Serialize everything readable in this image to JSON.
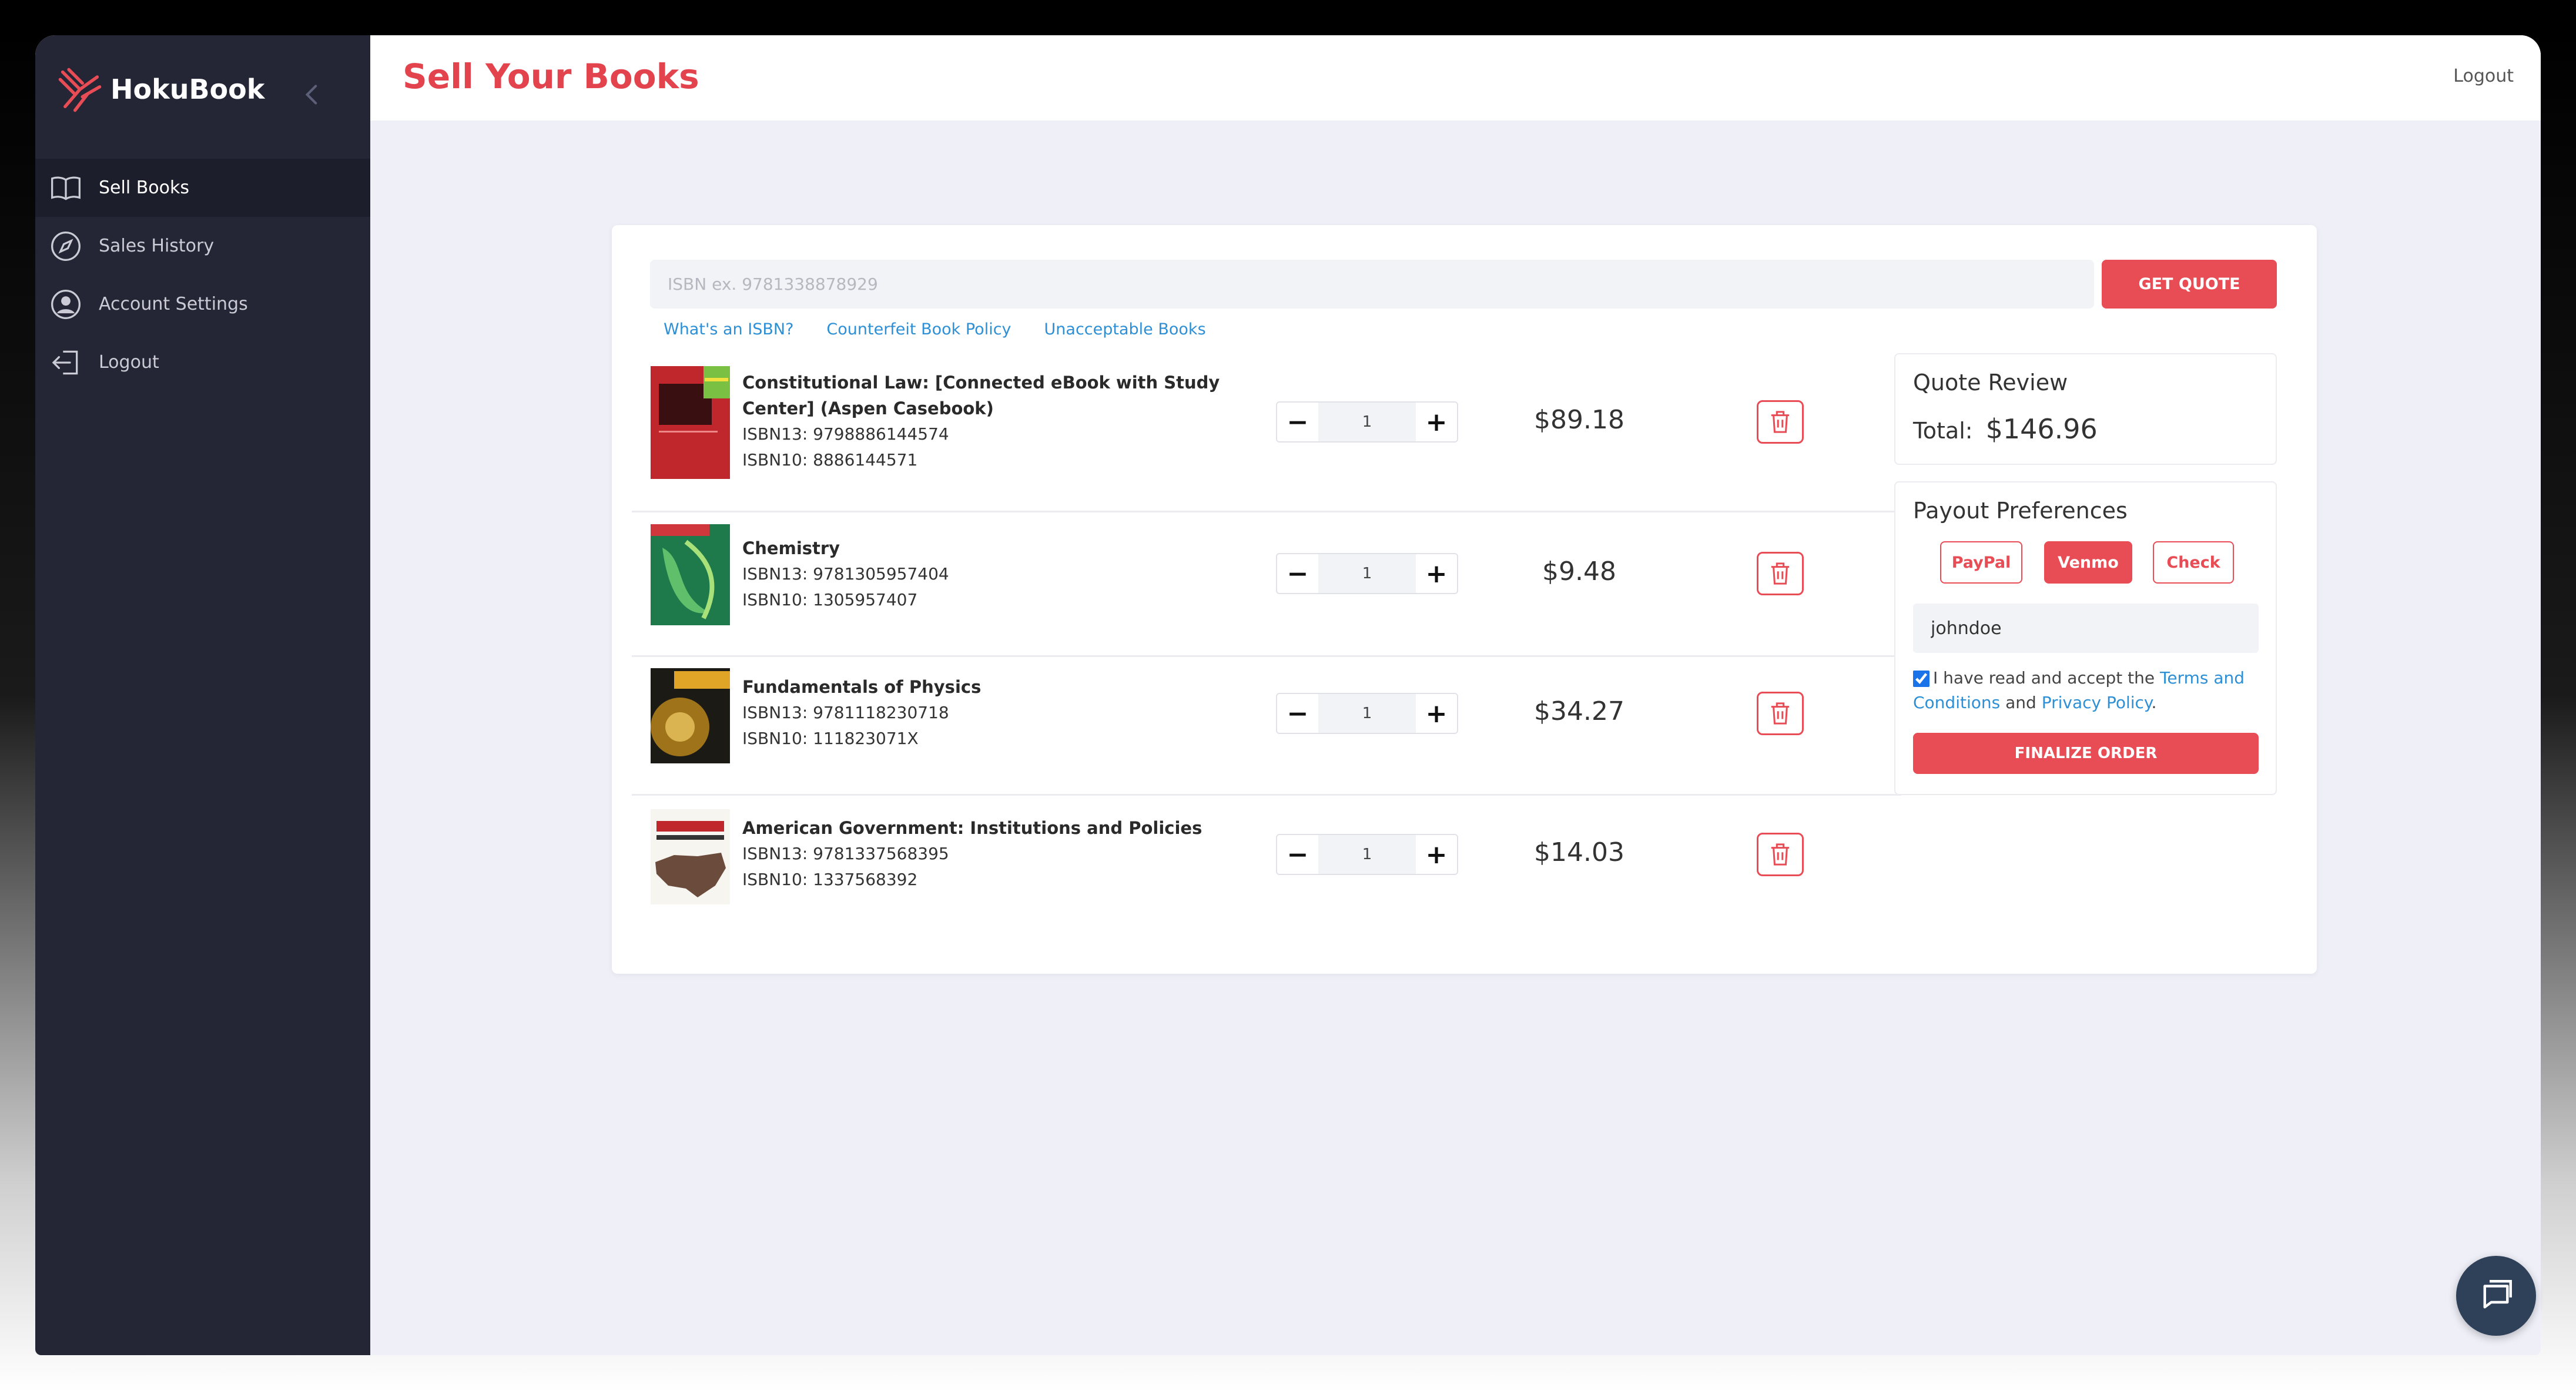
{
  "app": {
    "name": "HokuBook"
  },
  "sidebar": {
    "items": [
      {
        "label": "Sales History",
        "icon": "compass-icon"
      },
      {
        "label": "Account Settings",
        "icon": "user-circle-icon"
      },
      {
        "label": "Logout",
        "icon": "logout-icon"
      }
    ],
    "active": {
      "label": "Sell Books",
      "icon": "book-icon"
    }
  },
  "header": {
    "title": "Sell Your Books",
    "logout_label": "Logout"
  },
  "search": {
    "placeholder": "ISBN ex. 9781338878929",
    "value": "",
    "button_label": "GET QUOTE"
  },
  "help_links": [
    "What's an ISBN?",
    "Counterfeit Book Policy",
    "Unacceptable Books"
  ],
  "books": [
    {
      "title_line1": "Constitutional Law: [Connected eBook with Study",
      "title_line2": "Center] (Aspen Casebook)",
      "isbn13": "ISBN13: 9798886144574",
      "isbn10": "ISBN10: 8886144571",
      "quantity": "1",
      "price": "$89.18"
    },
    {
      "title_line1": "Chemistry",
      "isbn13": "ISBN13: 9781305957404",
      "isbn10": "ISBN10: 1305957407",
      "quantity": "1",
      "price": "$9.48"
    },
    {
      "title_line1": "Fundamentals of Physics",
      "isbn13": "ISBN13: 9781118230718",
      "isbn10": "ISBN10: 111823071X",
      "quantity": "1",
      "price": "$34.27"
    },
    {
      "title_line1": "American Government: Institutions and Policies",
      "isbn13": "ISBN13: 9781337568395",
      "isbn10": "ISBN10: 1337568392",
      "quantity": "1",
      "price": "$14.03"
    }
  ],
  "quote_review": {
    "title": "Quote Review",
    "total_label": "Total:",
    "total_value": "$146.96"
  },
  "payout": {
    "title": "Payout Preferences",
    "options": [
      "PayPal",
      "Venmo",
      "Check"
    ],
    "selected": "Venmo",
    "username_value": "johndoe",
    "terms_text_1": "I have read and accept the ",
    "terms_link": "Terms and Conditions",
    "terms_and": " and ",
    "privacy_link": "Privacy Policy",
    "terms_end": ".",
    "accepted": true,
    "finalize_label": "FINALIZE ORDER"
  },
  "colors": {
    "accent": "#e84c55",
    "sidebar_bg": "#242535",
    "link": "#2d8fd5",
    "page_bg": "#efeff8"
  }
}
